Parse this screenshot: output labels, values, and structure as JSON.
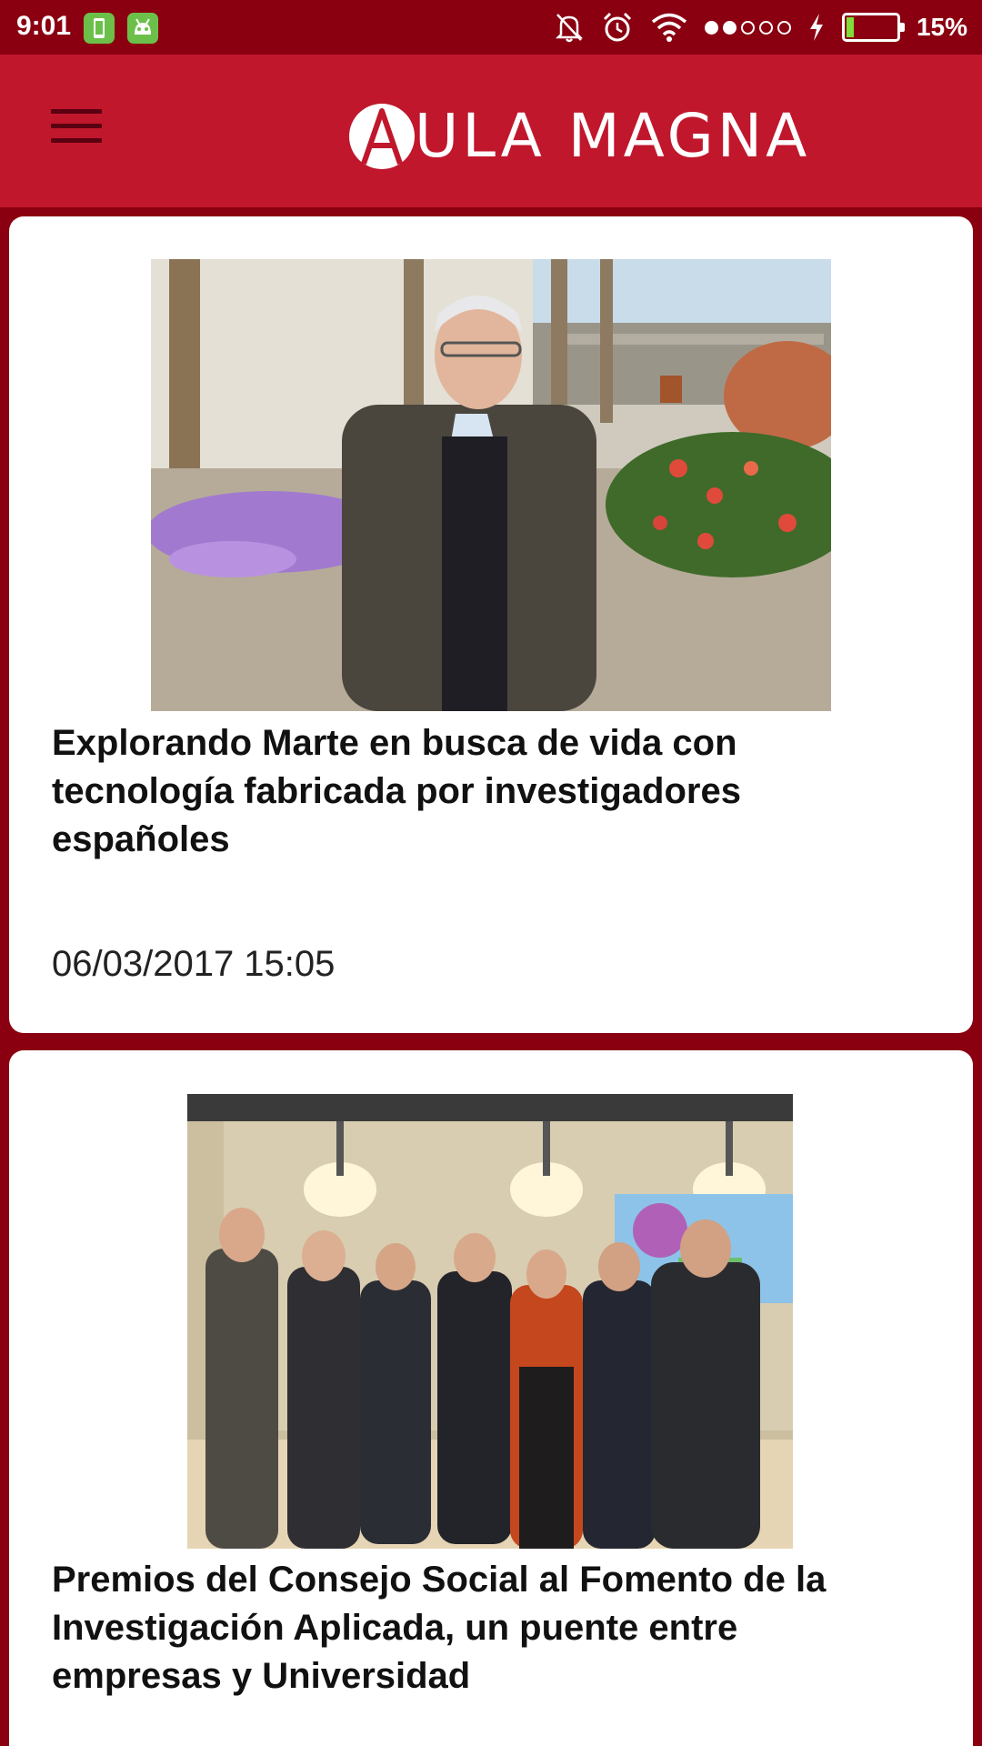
{
  "status_bar": {
    "time": "9:01",
    "battery_percent_text": "15%",
    "battery_level": 0.15,
    "signal_strength": 2,
    "signal_max": 5,
    "icons": [
      "phone-notification-icon",
      "android-notification-icon",
      "mute-bell-icon",
      "alarm-icon",
      "wifi-icon",
      "charging-icon",
      "battery-icon"
    ]
  },
  "header": {
    "logo_text": "ULA MAGNA",
    "logo_letter": "A",
    "menu_icon": "hamburger-menu-icon",
    "colors": {
      "header_bg": "#c0172d",
      "status_bg": "#8a0010"
    }
  },
  "articles": [
    {
      "title": "Explorando Marte en busca de vida con tecnología fabricada por investigadores españoles",
      "date": "06/03/2017 15:05",
      "image": "photo-man-in-garden"
    },
    {
      "title": "Premios del Consejo Social al Fomento de la Investigación Aplicada, un puente entre empresas y Universidad",
      "image": "photo-award-group"
    }
  ]
}
